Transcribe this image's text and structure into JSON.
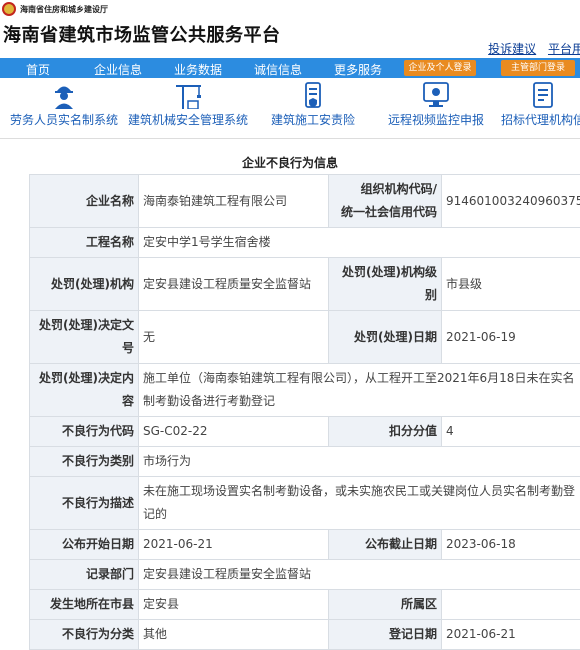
{
  "header": {
    "dept_name": "海南省住房和城乡建设厅",
    "site_title": "海南省建筑市场监管公共服务平台",
    "links": [
      "投诉建议",
      "平台用"
    ]
  },
  "nav": {
    "items": [
      "首页",
      "企业信息",
      "业务数据",
      "诚信信息",
      "更多服务"
    ],
    "buttons": [
      "企业及个人登录",
      "主管部门登录"
    ]
  },
  "quick_links": [
    {
      "label": "劳务人员实名制系统",
      "icon": "worker-icon"
    },
    {
      "label": "建筑机械安全管理系统",
      "icon": "crane-icon"
    },
    {
      "label": "建筑施工安责险",
      "icon": "insurance-icon"
    },
    {
      "label": "远程视频监控申报",
      "icon": "monitor-icon"
    },
    {
      "label": "招标代理机构信",
      "icon": "document-icon"
    }
  ],
  "detail": {
    "title": "企业不良行为信息",
    "company_name_label": "企业名称",
    "company_name": "海南泰铂建筑工程有限公司",
    "org_code_label_1": "组织机构代码/",
    "org_code_label_2": "统一社会信用代码",
    "org_code": "914601003240960375",
    "project_label": "工程名称",
    "project": "定安中学1号学生宿舍楼",
    "agency_label": "处罚(处理)机构",
    "agency": "定安县建设工程质量安全监督站",
    "agency_level_label": "处罚(处理)机构级别",
    "agency_level": "市县级",
    "doc_no_label": "处罚(处理)决定文号",
    "doc_no": "无",
    "penalty_date_label": "处罚(处理)日期",
    "penalty_date": "2021-06-19",
    "content_label": "处罚(处理)决定内容",
    "content": "施工单位（海南泰铂建筑工程有限公司），从工程开工至2021年6月18日未在实名制考勤设备进行考勤登记",
    "code_label": "不良行为代码",
    "code": "SG-C02-22",
    "score_label": "扣分分值",
    "score": "4",
    "category_label": "不良行为类别",
    "category": "市场行为",
    "desc_label": "不良行为描述",
    "desc": "未在施工现场设置实名制考勤设备，或未实施农民工或关键岗位人员实名制考勤登记的",
    "start_label": "公布开始日期",
    "start": "2021-06-21",
    "end_label": "公布截止日期",
    "end": "2023-06-18",
    "record_dept_label": "记录部门",
    "record_dept": "定安县建设工程质量安全监督站",
    "city_label": "发生地所在市县",
    "city": "定安县",
    "district_label": "所属区",
    "district": "",
    "class_label": "不良行为分类",
    "class": "其他",
    "reg_date_label": "登记日期",
    "reg_date": "2021-06-21"
  }
}
